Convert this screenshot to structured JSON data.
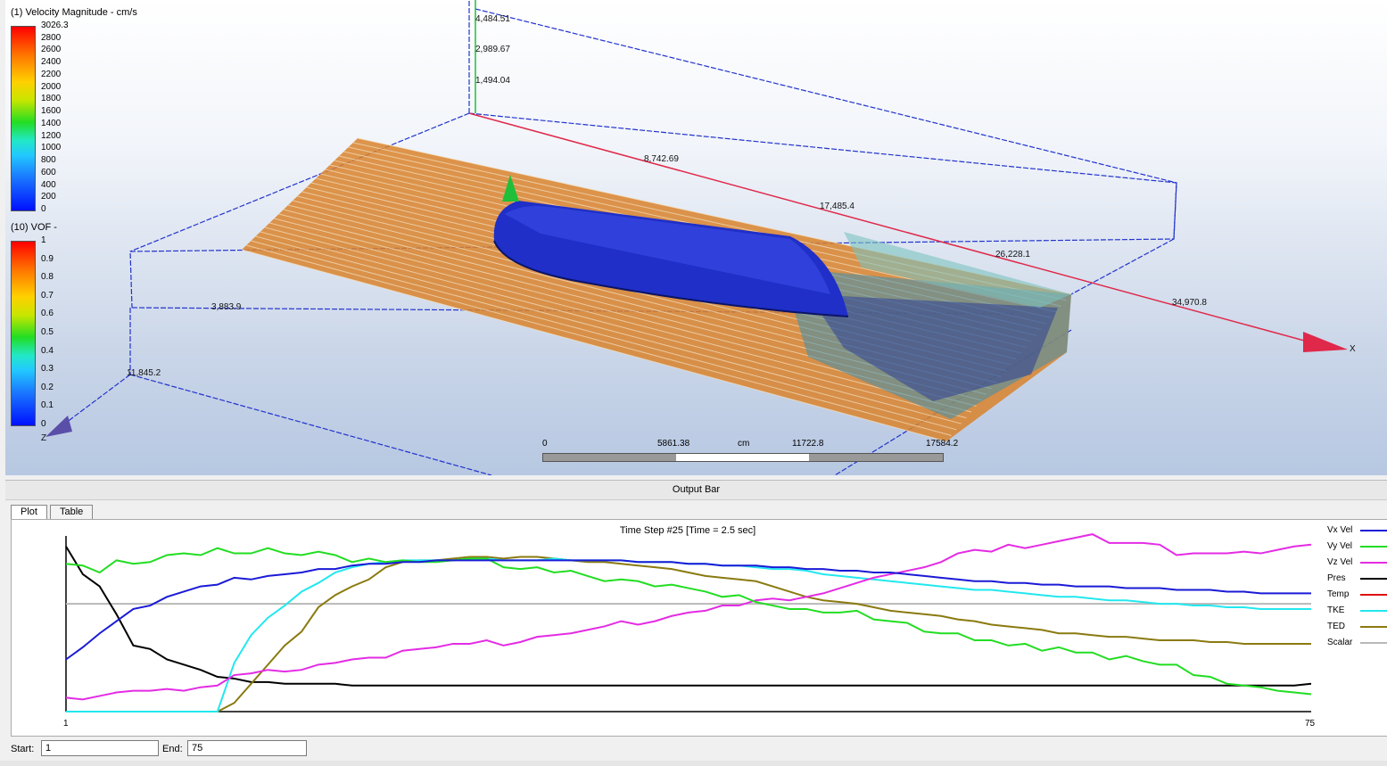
{
  "viewport": {
    "legend1": {
      "title": "(1) Velocity Magnitude - cm/s",
      "ticks": [
        "3026.3",
        "2800",
        "2600",
        "2400",
        "2200",
        "2000",
        "1800",
        "1600",
        "1400",
        "1200",
        "1000",
        "800",
        "600",
        "400",
        "200",
        "0"
      ]
    },
    "legend2": {
      "title": "(10) VOF -",
      "ticks": [
        "1",
        "0.9",
        "0.8",
        "0.7",
        "0.6",
        "0.5",
        "0.4",
        "0.3",
        "0.2",
        "0.1",
        "0"
      ]
    },
    "axis_labels": {
      "y1": "4,484.51",
      "y2": "2,989.67",
      "y3": "1,494.04",
      "x1": "8,742.69",
      "x2": "17,485.4",
      "x3": "26,228.1",
      "x4": "34,970.8",
      "z1": "3,883.9",
      "z2": "11,845.2",
      "x_axis_name": "X",
      "z_axis_name": "Z"
    },
    "scale": {
      "labels": [
        "0",
        "5861.38",
        "cm",
        "11722.8",
        "17584.2"
      ]
    },
    "colors": {
      "streamline": "#d9822b",
      "hull": "#1f2fc8",
      "x_arrow": "#e0284a",
      "z_arrow": "#5a4fa8",
      "y_arrow": "#1fbf3a"
    }
  },
  "output_bar": {
    "title": "Output Bar",
    "tabs": [
      "Plot",
      "Table"
    ],
    "active_tab": "Plot"
  },
  "plot": {
    "title": "Time Step #25 [Time = 2.5 sec]",
    "x_start_label": "1",
    "x_end_label": "75"
  },
  "chart_data": {
    "type": "line",
    "title": "Time Step #25 [Time = 2.5 sec]",
    "xlim": [
      1,
      75
    ],
    "ylim": [
      0,
      1
    ],
    "grid": false,
    "legend_position": "right",
    "series": [
      {
        "name": "Vx Vel",
        "color": "#1a1ad6",
        "values": [
          0.3,
          0.37,
          0.45,
          0.52,
          0.59,
          0.61,
          0.66,
          0.69,
          0.72,
          0.73,
          0.77,
          0.76,
          0.78,
          0.79,
          0.8,
          0.82,
          0.82,
          0.84,
          0.85,
          0.85,
          0.86,
          0.86,
          0.87,
          0.87,
          0.87,
          0.87,
          0.87,
          0.87,
          0.87,
          0.87,
          0.87,
          0.87,
          0.87,
          0.87,
          0.86,
          0.86,
          0.86,
          0.85,
          0.85,
          0.84,
          0.84,
          0.84,
          0.83,
          0.83,
          0.82,
          0.82,
          0.81,
          0.81,
          0.8,
          0.8,
          0.79,
          0.78,
          0.77,
          0.76,
          0.75,
          0.75,
          0.74,
          0.74,
          0.73,
          0.73,
          0.72,
          0.72,
          0.72,
          0.71,
          0.71,
          0.71,
          0.7,
          0.7,
          0.7,
          0.69,
          0.69,
          0.68,
          0.68,
          0.68,
          0.68
        ]
      },
      {
        "name": "Vy Vel",
        "color": "#22dd22",
        "values": [
          0.85,
          0.84,
          0.8,
          0.87,
          0.85,
          0.86,
          0.9,
          0.91,
          0.9,
          0.94,
          0.91,
          0.91,
          0.94,
          0.91,
          0.9,
          0.92,
          0.9,
          0.86,
          0.88,
          0.86,
          0.87,
          0.86,
          0.86,
          0.87,
          0.88,
          0.88,
          0.83,
          0.82,
          0.83,
          0.8,
          0.81,
          0.78,
          0.75,
          0.76,
          0.75,
          0.72,
          0.73,
          0.71,
          0.69,
          0.66,
          0.67,
          0.63,
          0.61,
          0.59,
          0.59,
          0.57,
          0.57,
          0.58,
          0.53,
          0.52,
          0.51,
          0.46,
          0.45,
          0.45,
          0.41,
          0.41,
          0.38,
          0.39,
          0.35,
          0.37,
          0.34,
          0.34,
          0.3,
          0.32,
          0.29,
          0.27,
          0.27,
          0.21,
          0.2,
          0.16,
          0.15,
          0.14,
          0.12,
          0.11,
          0.1
        ]
      },
      {
        "name": "Vz Vel",
        "color": "#e42be4",
        "values": [
          0.08,
          0.07,
          0.09,
          0.11,
          0.12,
          0.12,
          0.13,
          0.12,
          0.14,
          0.15,
          0.21,
          0.22,
          0.24,
          0.23,
          0.24,
          0.27,
          0.28,
          0.3,
          0.31,
          0.31,
          0.35,
          0.36,
          0.37,
          0.39,
          0.39,
          0.41,
          0.38,
          0.4,
          0.43,
          0.44,
          0.45,
          0.47,
          0.49,
          0.52,
          0.5,
          0.52,
          0.55,
          0.57,
          0.58,
          0.61,
          0.61,
          0.64,
          0.65,
          0.64,
          0.66,
          0.68,
          0.71,
          0.74,
          0.77,
          0.79,
          0.81,
          0.83,
          0.86,
          0.91,
          0.93,
          0.92,
          0.96,
          0.94,
          0.96,
          0.98,
          1.0,
          1.02,
          0.97,
          0.97,
          0.97,
          0.96,
          0.9,
          0.91,
          0.91,
          0.91,
          0.92,
          0.91,
          0.93,
          0.95,
          0.96
        ]
      },
      {
        "name": "Pres",
        "color": "#000000",
        "values": [
          0.95,
          0.79,
          0.72,
          0.56,
          0.38,
          0.36,
          0.3,
          0.27,
          0.24,
          0.2,
          0.19,
          0.17,
          0.17,
          0.16,
          0.16,
          0.16,
          0.16,
          0.15,
          0.15,
          0.15,
          0.15,
          0.15,
          0.15,
          0.15,
          0.15,
          0.15,
          0.15,
          0.15,
          0.15,
          0.15,
          0.15,
          0.15,
          0.15,
          0.15,
          0.15,
          0.15,
          0.15,
          0.15,
          0.15,
          0.15,
          0.15,
          0.15,
          0.15,
          0.15,
          0.15,
          0.15,
          0.15,
          0.15,
          0.15,
          0.15,
          0.15,
          0.15,
          0.15,
          0.15,
          0.15,
          0.15,
          0.15,
          0.15,
          0.15,
          0.15,
          0.15,
          0.15,
          0.15,
          0.15,
          0.15,
          0.15,
          0.15,
          0.15,
          0.15,
          0.15,
          0.15,
          0.15,
          0.15,
          0.15,
          0.16
        ]
      },
      {
        "name": "Temp",
        "color": "#e01010",
        "values": []
      },
      {
        "name": "TKE",
        "color": "#22e8ee",
        "values": [
          0,
          0,
          0,
          0,
          0,
          0,
          0,
          0,
          0,
          0,
          0.28,
          0.44,
          0.54,
          0.61,
          0.69,
          0.74,
          0.8,
          0.83,
          0.85,
          0.86,
          0.87,
          0.87,
          0.87,
          0.87,
          0.88,
          0.88,
          0.87,
          0.87,
          0.87,
          0.88,
          0.87,
          0.87,
          0.87,
          0.87,
          0.86,
          0.86,
          0.86,
          0.85,
          0.85,
          0.84,
          0.84,
          0.83,
          0.82,
          0.82,
          0.81,
          0.79,
          0.78,
          0.77,
          0.76,
          0.75,
          0.74,
          0.73,
          0.72,
          0.71,
          0.7,
          0.7,
          0.69,
          0.68,
          0.67,
          0.66,
          0.66,
          0.65,
          0.64,
          0.64,
          0.63,
          0.62,
          0.62,
          0.61,
          0.61,
          0.6,
          0.6,
          0.59,
          0.59,
          0.59,
          0.59
        ]
      },
      {
        "name": "TED",
        "color": "#8a7a10",
        "values": [
          0,
          0,
          0,
          0,
          0,
          0,
          0,
          0,
          0,
          0,
          0.05,
          0.16,
          0.27,
          0.38,
          0.46,
          0.6,
          0.67,
          0.72,
          0.76,
          0.83,
          0.86,
          0.87,
          0.87,
          0.88,
          0.89,
          0.89,
          0.88,
          0.89,
          0.89,
          0.88,
          0.87,
          0.86,
          0.86,
          0.85,
          0.84,
          0.83,
          0.82,
          0.8,
          0.78,
          0.77,
          0.76,
          0.75,
          0.72,
          0.69,
          0.66,
          0.64,
          0.63,
          0.62,
          0.6,
          0.58,
          0.57,
          0.56,
          0.55,
          0.53,
          0.52,
          0.5,
          0.49,
          0.48,
          0.47,
          0.45,
          0.45,
          0.44,
          0.43,
          0.43,
          0.42,
          0.41,
          0.41,
          0.41,
          0.4,
          0.4,
          0.39,
          0.39,
          0.39,
          0.39,
          0.39
        ]
      },
      {
        "name": "Scalar",
        "color": "#b8b8b8",
        "values": [
          0.62,
          0.62,
          0.62,
          0.62,
          0.62,
          0.62,
          0.62,
          0.62,
          0.62,
          0.62,
          0.62,
          0.62,
          0.62,
          0.62,
          0.62,
          0.62,
          0.62,
          0.62,
          0.62,
          0.62,
          0.62,
          0.62,
          0.62,
          0.62,
          0.62,
          0.62,
          0.62,
          0.62,
          0.62,
          0.62,
          0.62,
          0.62,
          0.62,
          0.62,
          0.62,
          0.62,
          0.62,
          0.62,
          0.62,
          0.62,
          0.62,
          0.62,
          0.62,
          0.62,
          0.62,
          0.62,
          0.62,
          0.62,
          0.62,
          0.62,
          0.62,
          0.62,
          0.62,
          0.62,
          0.62,
          0.62,
          0.62,
          0.62,
          0.62,
          0.62,
          0.62,
          0.62,
          0.62,
          0.62,
          0.62,
          0.62,
          0.62,
          0.62,
          0.62,
          0.62,
          0.62,
          0.62,
          0.62,
          0.62,
          0.62
        ]
      }
    ]
  },
  "range": {
    "start_label": "Start:",
    "start_value": "1",
    "end_label": "End:",
    "end_value": "75"
  }
}
